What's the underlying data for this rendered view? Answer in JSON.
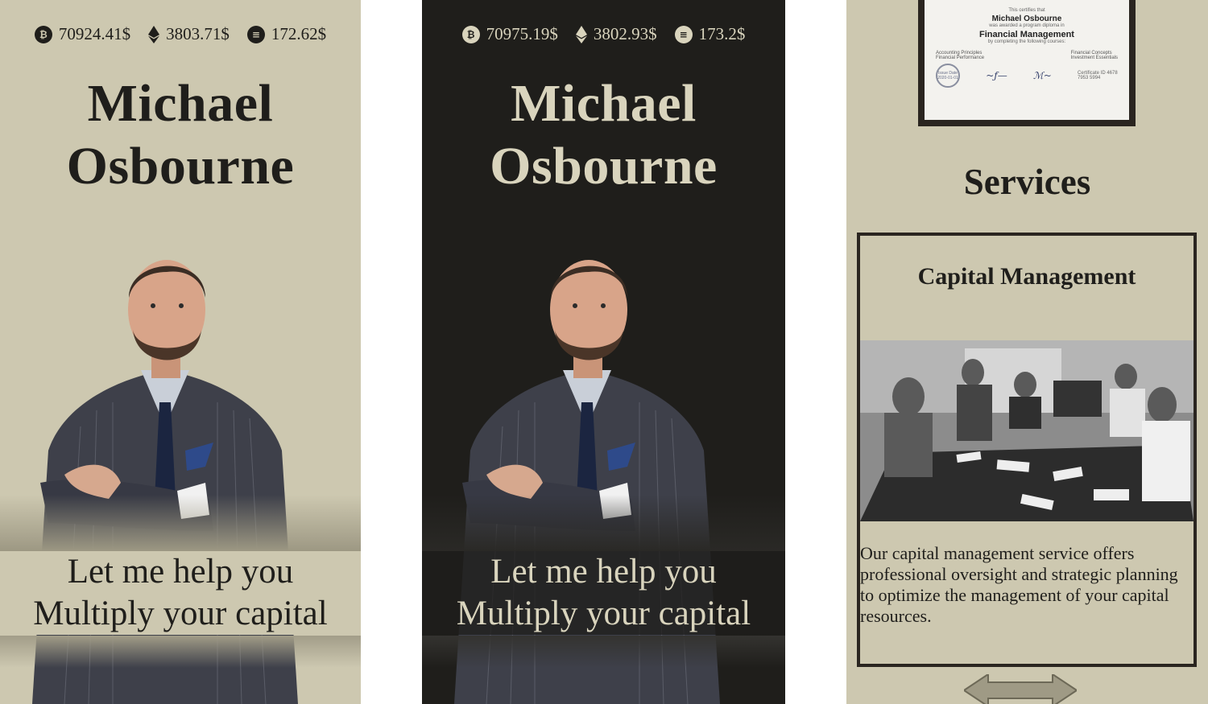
{
  "colors": {
    "sand": "#cdc8b0",
    "charcoal": "#1f1e1b",
    "cream_text": "#d9d4bd"
  },
  "panels": {
    "light": {
      "ticker": [
        {
          "icon": "bitcoin-icon",
          "symbol": "₿",
          "price": "70924.41$"
        },
        {
          "icon": "ethereum-icon",
          "symbol": "",
          "price": "3803.71$"
        },
        {
          "icon": "solana-icon",
          "symbol": "≡",
          "price": "172.62$"
        }
      ],
      "name_first": "Michael",
      "name_last": "Osbourne",
      "tagline_line1": "Let me help you",
      "tagline_line2": "Multiply your capital"
    },
    "dark": {
      "ticker": [
        {
          "icon": "bitcoin-icon",
          "symbol": "₿",
          "price": "70975.19$"
        },
        {
          "icon": "ethereum-icon",
          "symbol": "",
          "price": "3802.93$"
        },
        {
          "icon": "solana-icon",
          "symbol": "≡",
          "price": "173.2$"
        }
      ],
      "name_first": "Michael",
      "name_last": "Osbourne",
      "tagline_line1": "Let me help you",
      "tagline_line2": "Multiply your capital"
    }
  },
  "certificate": {
    "certifies": "This certifies that",
    "recipient": "Michael Osbourne",
    "awarded": "was awarded a program diploma in",
    "program": "Financial Management",
    "completing": "by completing the following courses:",
    "courses_left": [
      "Accounting Principles",
      "Financial Performance"
    ],
    "courses_right": [
      "Financial Concepts",
      "Investment Essentials"
    ],
    "seal_label": "Issue Date 2020-01-01",
    "certificate_id": "Certificate ID 4678 7953 5994"
  },
  "services": {
    "title": "Services",
    "card": {
      "title": "Capital Management",
      "description": "Our capital management service offers professional oversight and strategic planning to optimize the management of your capital resources."
    }
  }
}
